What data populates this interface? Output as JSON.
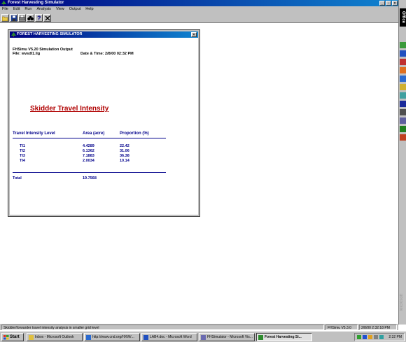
{
  "window": {
    "title": "Forest Harvesting Simulator"
  },
  "menu": [
    "File",
    "Edit",
    "Run",
    "Analysis",
    "View",
    "Output",
    "Help"
  ],
  "toolbar": [
    "open-icon",
    "save-icon",
    "print-icon",
    "binoculars-icon",
    "help-icon",
    "close-x-icon"
  ],
  "child": {
    "title": "FOREST HARVESTING SIMULATOR",
    "header_line1": "FHSimu V5.20 Simulation Output",
    "file_label": "File: wvsdl1.lig",
    "datetime": "Date & Time: 2/8/00 02:32 PM",
    "report_title": "Skidder Travel Intensity",
    "columns": [
      "Travel Intensity Level",
      "Area (acre)",
      "Proportion (%)"
    ],
    "rows": [
      {
        "level": "TI1",
        "area": "4.4289",
        "proportion": "22.42"
      },
      {
        "level": "TI2",
        "area": "6.1362",
        "proportion": "31.06"
      },
      {
        "level": "TI3",
        "area": "7.1883",
        "proportion": "36.38"
      },
      {
        "level": "TI4",
        "area": "2.0034",
        "proportion": "10.14"
      }
    ],
    "total_label": "Total",
    "total_area": "19.7568"
  },
  "status": {
    "message": "Skidder/forwarder travel intensity analysis in smaller grid level",
    "version": "FHSimu V5.3.0",
    "datetime": "2/8/00 2:32:18 PM"
  },
  "officebar": {
    "logo": "Office",
    "footer": "Microsoft"
  },
  "taskbar": {
    "start": "Start",
    "tasks": [
      "Inbox - Microsoft Outlook",
      "http://www.cnd.org/HXW/...",
      "LAB4.doc - Microsoft Word",
      "FHSimulator - Microsoft Vis...",
      "Forest Harvesting Si..."
    ],
    "clock": "2:32 PM"
  },
  "colors": {
    "title_bar": "#000080",
    "report_title": "#b00000",
    "table_text": "#00008b",
    "chrome": "#c0c0c0"
  }
}
